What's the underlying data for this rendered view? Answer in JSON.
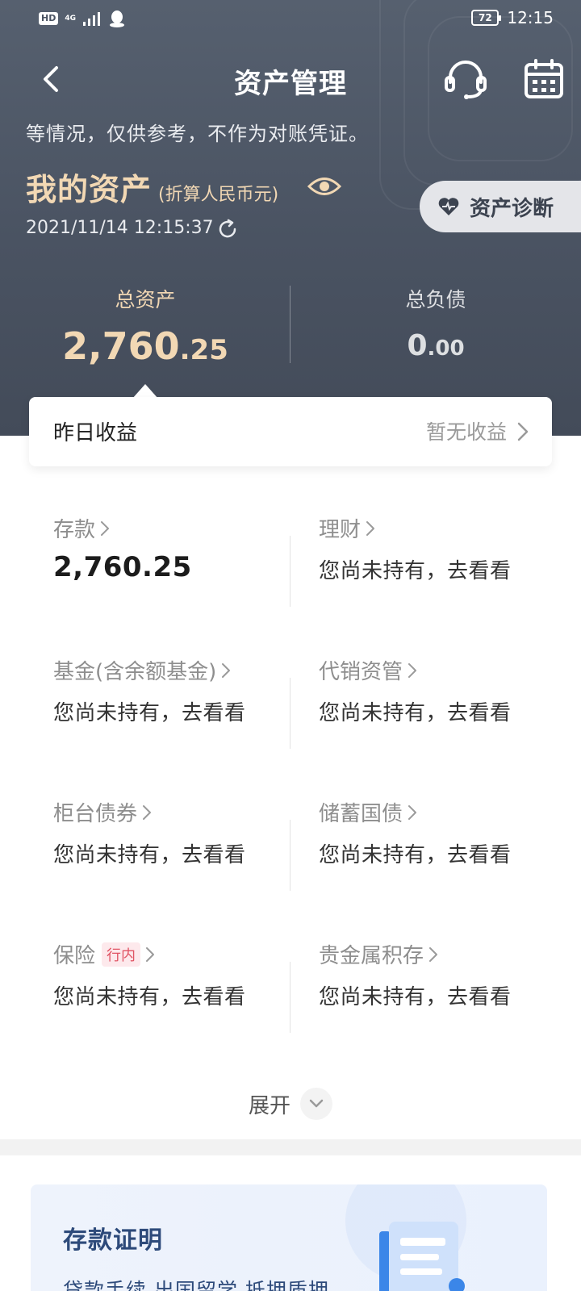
{
  "status_bar": {
    "hd": "HD",
    "network": "4G",
    "battery": "72",
    "time": "12:15"
  },
  "nav": {
    "title": "资产管理"
  },
  "header": {
    "disclaimer": "等情况，仅供参考，不作为对账凭证。",
    "assets_title": "我的资产",
    "assets_unit": "(折算人民币元)",
    "timestamp": "2021/11/14 12:15:37",
    "diagnose_label": "资产诊断",
    "total_assets_label": "总资产",
    "total_assets_int": "2,760",
    "total_assets_dec": ".25",
    "total_liab_label": "总负债",
    "total_liab_int": "0",
    "total_liab_dec": ".00"
  },
  "income": {
    "label": "昨日收益",
    "value": "暂无收益"
  },
  "categories": [
    {
      "title": "存款",
      "value": "2,760.25"
    },
    {
      "title": "理财",
      "value": "您尚未持有，去看看"
    },
    {
      "title": "基金(含余额基金)",
      "value": "您尚未持有，去看看"
    },
    {
      "title": "代销资管",
      "value": "您尚未持有，去看看"
    },
    {
      "title": "柜台债券",
      "value": "您尚未持有，去看看"
    },
    {
      "title": "储蓄国债",
      "value": "您尚未持有，去看看"
    },
    {
      "title": "保险",
      "tag": "行内",
      "value": "您尚未持有，去看看"
    },
    {
      "title": "贵金属积存",
      "value": "您尚未持有，去看看"
    }
  ],
  "expand_label": "展开",
  "certificate": {
    "title": "存款证明",
    "desc": "贷款手续 出国留学 抵押质押"
  },
  "colors": {
    "header_bg": "#4a5362",
    "gold": "#f2d8b4",
    "tag_red": "#e05464",
    "cert_blue": "#2d4a7a"
  }
}
